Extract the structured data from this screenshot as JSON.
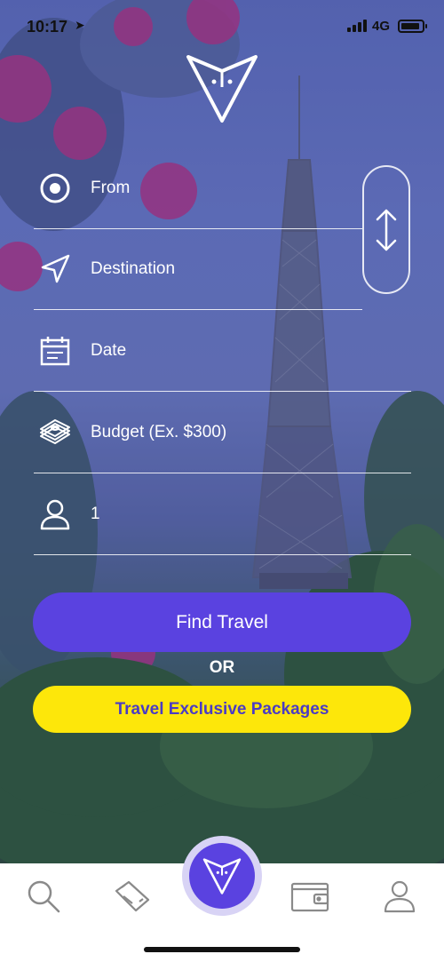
{
  "status_bar": {
    "time": "10:17",
    "network": "4G"
  },
  "form": {
    "from_label": "From",
    "destination_label": "Destination",
    "date_label": "Date",
    "budget_label": "Budget (Ex. $300)",
    "travelers_value": "1"
  },
  "actions": {
    "find_label": "Find Travel",
    "or_label": "OR",
    "packages_label": "Travel Exclusive Packages"
  },
  "tabbar": {
    "items": [
      "search-icon",
      "tickets-icon",
      "logo-icon",
      "wallet-icon",
      "profile-icon"
    ],
    "active": "logo-icon"
  },
  "colors": {
    "accent": "#5a42e0",
    "highlight": "#fde70a",
    "packages_text": "#4b3cc4"
  }
}
